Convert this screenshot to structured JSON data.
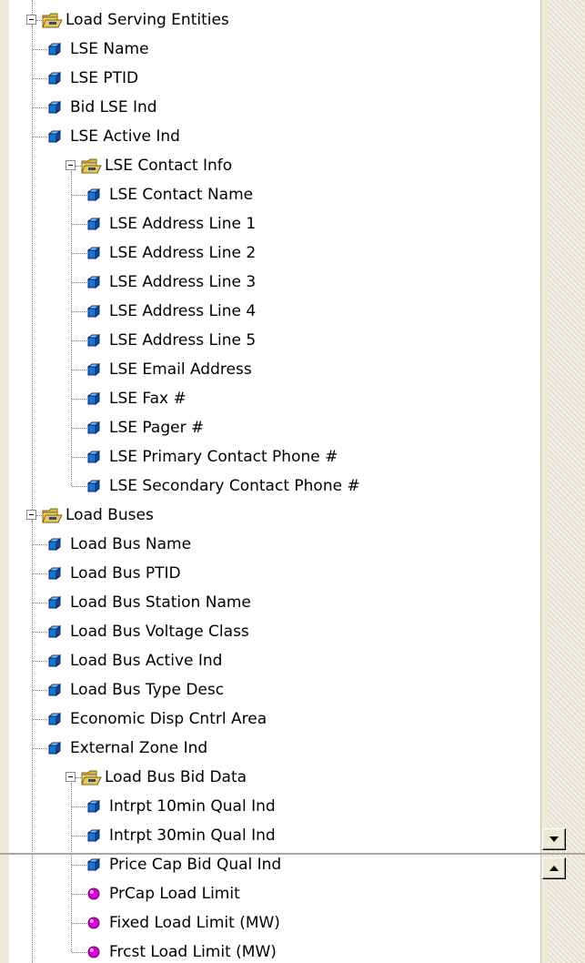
{
  "tree": [
    {
      "label": "Load Serving Entities",
      "icon": "folder-open-icon",
      "level": 0,
      "kind": "folder"
    },
    {
      "label": "LSE Name",
      "icon": "field-cube-icon",
      "level": 1,
      "kind": "field"
    },
    {
      "label": "LSE PTID",
      "icon": "field-cube-icon",
      "level": 1,
      "kind": "field"
    },
    {
      "label": "Bid LSE Ind",
      "icon": "field-cube-icon",
      "level": 1,
      "kind": "field"
    },
    {
      "label": "LSE Active Ind",
      "icon": "field-cube-icon",
      "level": 1,
      "kind": "field"
    },
    {
      "label": "LSE Contact Info",
      "icon": "folder-open-icon",
      "level": 1,
      "kind": "folder"
    },
    {
      "label": "LSE Contact Name",
      "icon": "field-cube-icon",
      "level": 2,
      "kind": "field"
    },
    {
      "label": "LSE Address Line 1",
      "icon": "field-cube-icon",
      "level": 2,
      "kind": "field"
    },
    {
      "label": "LSE Address Line 2",
      "icon": "field-cube-icon",
      "level": 2,
      "kind": "field"
    },
    {
      "label": "LSE Address Line 3",
      "icon": "field-cube-icon",
      "level": 2,
      "kind": "field"
    },
    {
      "label": "LSE Address Line 4",
      "icon": "field-cube-icon",
      "level": 2,
      "kind": "field"
    },
    {
      "label": "LSE Address Line 5",
      "icon": "field-cube-icon",
      "level": 2,
      "kind": "field"
    },
    {
      "label": "LSE Email Address",
      "icon": "field-cube-icon",
      "level": 2,
      "kind": "field"
    },
    {
      "label": "LSE Fax #",
      "icon": "field-cube-icon",
      "level": 2,
      "kind": "field"
    },
    {
      "label": "LSE Pager #",
      "icon": "field-cube-icon",
      "level": 2,
      "kind": "field"
    },
    {
      "label": "LSE Primary Contact Phone #",
      "icon": "field-cube-icon",
      "level": 2,
      "kind": "field"
    },
    {
      "label": "LSE Secondary Contact Phone #",
      "icon": "field-cube-icon",
      "level": 2,
      "kind": "field"
    },
    {
      "label": "Load Buses",
      "icon": "folder-open-icon",
      "level": 0,
      "kind": "folder"
    },
    {
      "label": "Load Bus Name",
      "icon": "field-cube-icon",
      "level": 1,
      "kind": "field"
    },
    {
      "label": "Load Bus PTID",
      "icon": "field-cube-icon",
      "level": 1,
      "kind": "field"
    },
    {
      "label": "Load Bus Station Name",
      "icon": "field-cube-icon",
      "level": 1,
      "kind": "field"
    },
    {
      "label": "Load Bus Voltage Class",
      "icon": "field-cube-icon",
      "level": 1,
      "kind": "field"
    },
    {
      "label": "Load Bus Active Ind",
      "icon": "field-cube-icon",
      "level": 1,
      "kind": "field"
    },
    {
      "label": "Load Bus Type Desc",
      "icon": "field-cube-icon",
      "level": 1,
      "kind": "field"
    },
    {
      "label": "Economic Disp Cntrl Area",
      "icon": "field-cube-icon",
      "level": 1,
      "kind": "field"
    },
    {
      "label": "External Zone Ind",
      "icon": "field-cube-icon",
      "level": 1,
      "kind": "field"
    },
    {
      "label": "Load Bus Bid Data",
      "icon": "folder-open-icon",
      "level": 1,
      "kind": "folder"
    },
    {
      "label": "Intrpt 10min Qual Ind",
      "icon": "field-cube-icon",
      "level": 2,
      "kind": "field"
    },
    {
      "label": "Intrpt 30min Qual Ind",
      "icon": "field-cube-icon",
      "level": 2,
      "kind": "field"
    },
    {
      "label": "Price Cap Bid Qual Ind",
      "icon": "field-cube-icon",
      "level": 2,
      "kind": "field"
    },
    {
      "label": "PrCap Load Limit",
      "icon": "measure-ball-icon",
      "level": 2,
      "kind": "measure"
    },
    {
      "label": "Fixed Load Limit (MW)",
      "icon": "measure-ball-icon",
      "level": 2,
      "kind": "measure"
    },
    {
      "label": "Frcst Load Limit (MW)",
      "icon": "measure-ball-icon",
      "level": 2,
      "kind": "measure"
    }
  ],
  "scroll": {
    "down_icon": "scroll-down-arrow-icon",
    "up_icon": "scroll-up-arrow-icon"
  },
  "colors": {
    "cube": "#1874cd",
    "ball": "#d000d0",
    "folder": "#d8b848"
  }
}
